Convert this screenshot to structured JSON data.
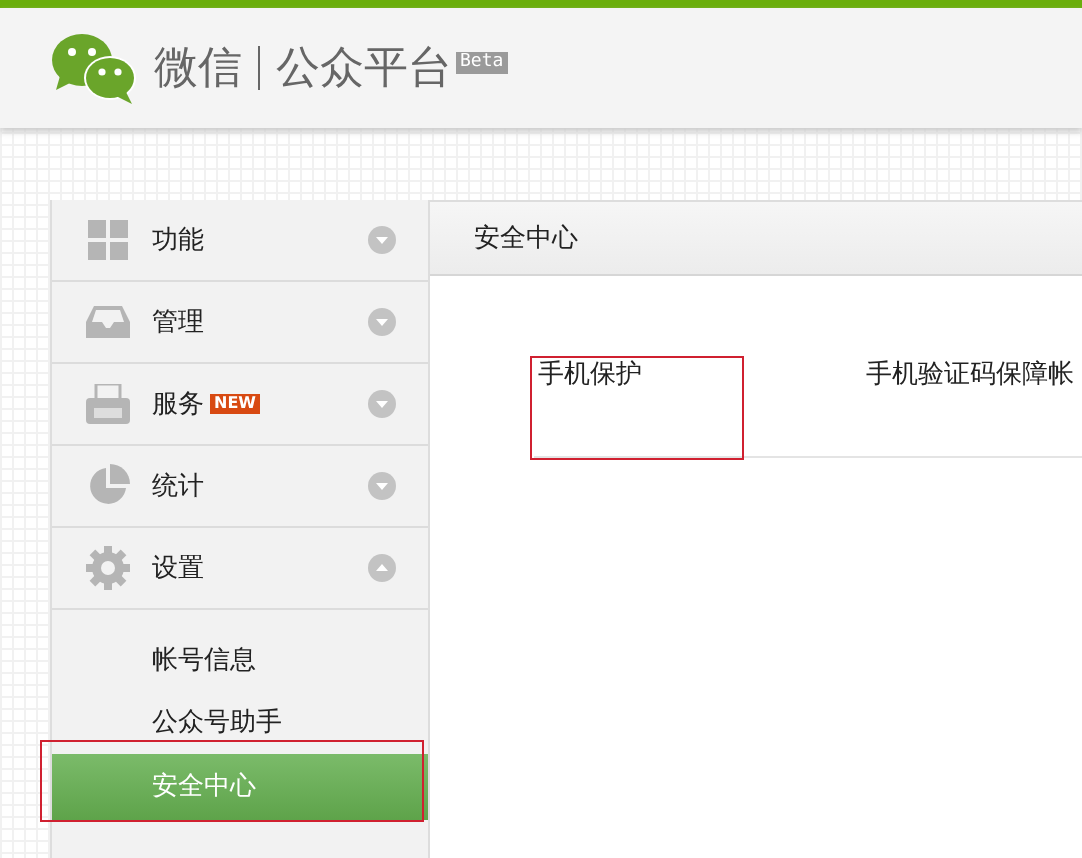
{
  "header": {
    "brand": "微信",
    "product": "公众平台",
    "badge": "Beta"
  },
  "sidebar": {
    "items": [
      {
        "label": "功能",
        "expanded": false
      },
      {
        "label": "管理",
        "expanded": false
      },
      {
        "label": "服务",
        "badge": "NEW",
        "expanded": false
      },
      {
        "label": "统计",
        "expanded": false
      },
      {
        "label": "设置",
        "expanded": true,
        "children": [
          {
            "label": "帐号信息",
            "selected": false
          },
          {
            "label": "公众号助手",
            "selected": false
          },
          {
            "label": "安全中心",
            "selected": true
          }
        ]
      }
    ]
  },
  "main": {
    "title": "安全中心",
    "rows": [
      {
        "label": "手机保护",
        "description": "手机验证码保障帐"
      }
    ]
  }
}
